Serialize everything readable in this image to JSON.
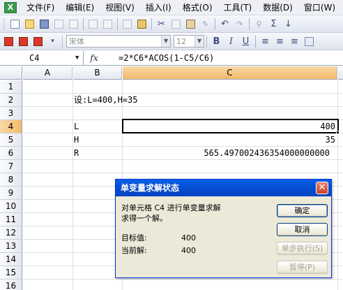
{
  "menubar": {
    "items": [
      "文件(F)",
      "编辑(E)",
      "视图(V)",
      "插入(I)",
      "格式(O)",
      "工具(T)",
      "数据(D)",
      "窗口(W)"
    ]
  },
  "toolbar": {
    "font_name": "宋体",
    "font_size": "12"
  },
  "formula_bar": {
    "name_box": "C4",
    "fx_label": "fx",
    "formula": "=2*C6*ACOS(1-C5/C6)"
  },
  "columns": [
    "A",
    "B",
    "C"
  ],
  "selected_column": "C",
  "rows": [
    "1",
    "2",
    "3",
    "4",
    "5",
    "6",
    "7",
    "8",
    "9",
    "10",
    "11",
    "12",
    "13",
    "14",
    "15",
    "16"
  ],
  "selected_row": "4",
  "cells": {
    "B2": "设:L=400,H=35",
    "B4": "L",
    "C4": "400",
    "B5": "H",
    "C5": "35",
    "B6": "R",
    "C6": "565.497002436354000000000"
  },
  "dialog": {
    "title": "单变量求解状态",
    "close_label": "✕",
    "message_line1": "对单元格 C4 进行单变量求解",
    "message_line2": "求得一个解。",
    "target_label": "目标值:",
    "target_value": "400",
    "current_label": "当前解:",
    "current_value": "400",
    "ok_label": "确定",
    "cancel_label": "取消",
    "step_label": "单步执行(S)",
    "pause_label": "暂停(P)"
  }
}
